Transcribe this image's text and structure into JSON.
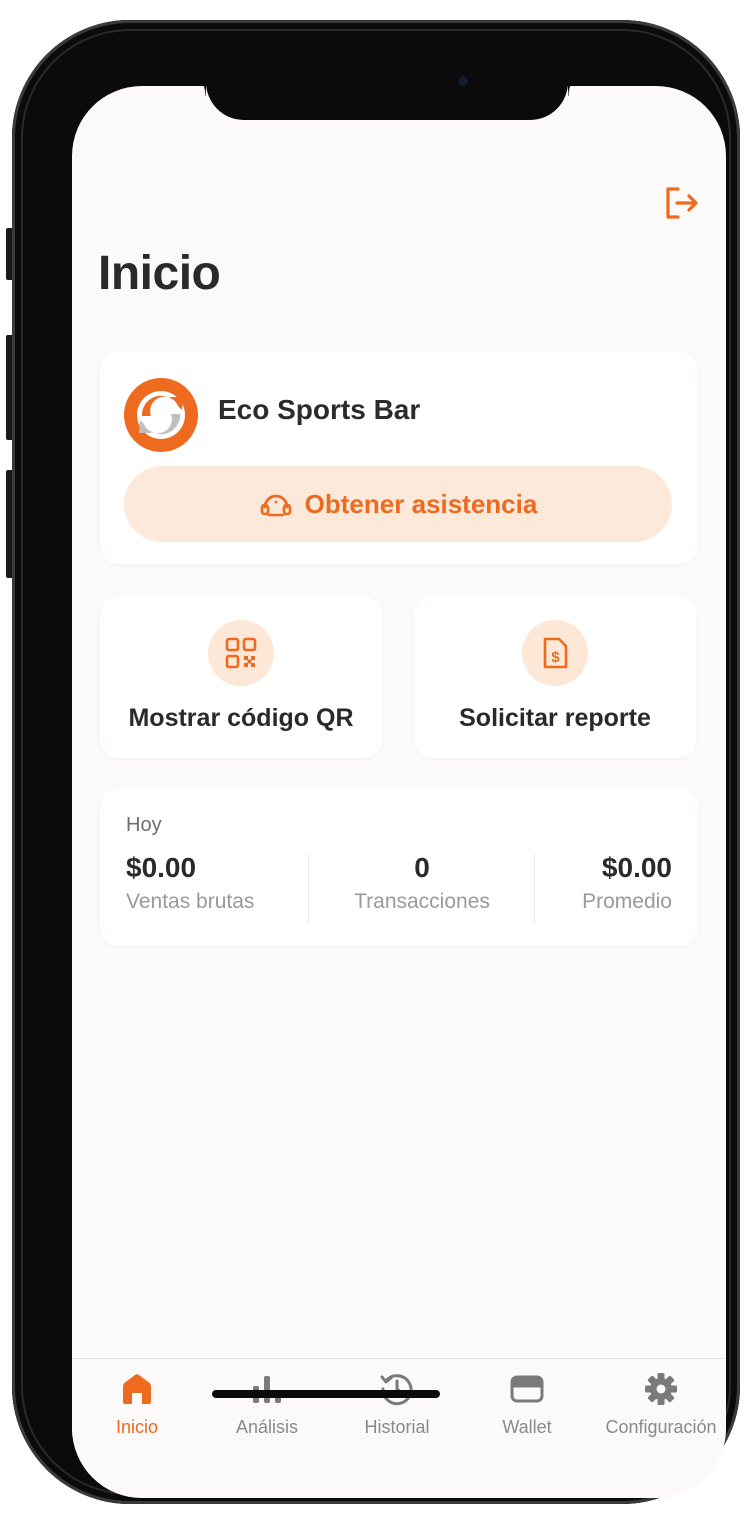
{
  "header": {
    "title": "Inicio"
  },
  "business": {
    "name": "Eco Sports Bar",
    "help_label": "Obtener asistencia"
  },
  "actions": [
    {
      "label": "Mostrar código QR",
      "icon": "qr-code-icon"
    },
    {
      "label": "Solicitar reporte",
      "icon": "report-document-icon"
    }
  ],
  "summary": {
    "period": "Hoy",
    "stats": [
      {
        "value": "$0.00",
        "label": "Ventas brutas"
      },
      {
        "value": "0",
        "label": "Transacciones"
      },
      {
        "value": "$0.00",
        "label": "Promedio"
      }
    ]
  },
  "tabs": [
    {
      "label": "Inicio",
      "icon": "home-icon",
      "active": true
    },
    {
      "label": "Análisis",
      "icon": "bar-chart-icon",
      "active": false
    },
    {
      "label": "Historial",
      "icon": "history-icon",
      "active": false
    },
    {
      "label": "Wallet",
      "icon": "wallet-icon",
      "active": false
    },
    {
      "label": "Configuración",
      "icon": "gear-icon",
      "active": false
    }
  ],
  "colors": {
    "accent": "#ee6a1f",
    "accent_soft": "#fde9da",
    "text": "#2a2a2a",
    "muted": "#9a9a9a"
  }
}
